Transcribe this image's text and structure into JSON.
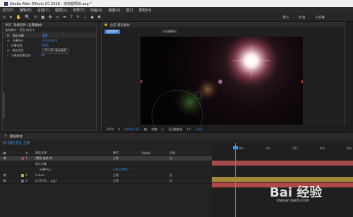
{
  "titlebar": {
    "title": "Adobe After Effects CC 2018 - 无标题项目.aep *"
  },
  "menu": [
    "文件(F)",
    "编辑(E)",
    "合成(C)",
    "图层(L)",
    "效果(T)",
    "动画(A)",
    "视图(V)",
    "窗口",
    "帮助(H)"
  ],
  "toolbar": {
    "workspaces": [
      "默认",
      "标准",
      "小屏幕"
    ]
  },
  "left_panel": {
    "tabs": [
      "项目",
      "效果控件 (光晕素材)"
    ],
    "title": "粗角素材 • 黑色 纯色 1",
    "effect_name": "镜头光晕",
    "reset": "重置",
    "props": [
      {
        "name": "光晕中心",
        "value": "374.0,94.0"
      },
      {
        "name": "光晕亮度",
        "value": "129%"
      },
      {
        "name": "镜头类型",
        "value": "50-300 毫米变焦"
      },
      {
        "name": "与原始图像混合",
        "value": "0%"
      }
    ]
  },
  "viewer": {
    "tabs": [
      "合成 粗角素材"
    ],
    "comp_tab": "粗角素材",
    "top_label": "活动摄像机",
    "zoom": "100%",
    "timecode": "0:00:01:16",
    "quality": "完整",
    "camera": "活动摄像机",
    "views": "1个",
    "exposure": "+0.0"
  },
  "timeline": {
    "tab": "粗角素材",
    "timecode": "0:00:01:16",
    "headers": {
      "num": "#",
      "name": "图层名称",
      "mode": "模式",
      "trkmat": "TrkMat",
      "parent": "父级"
    },
    "ruler": [
      "00s",
      "01s",
      "02s",
      "03s",
      "04s"
    ],
    "layers": [
      {
        "num": "1",
        "name": "[黑色 纯色 1]",
        "mode": "正常",
        "parent": "无",
        "color": "#b83c3c"
      },
      {
        "num": "",
        "name": "镜头光晕",
        "mode": "",
        "parent": "",
        "color": ""
      },
      {
        "num": "",
        "name": "光晕中心",
        "mode": "",
        "parent": "374.0,94.0",
        "color": ""
      },
      {
        "num": "2",
        "name": "Future",
        "mode": "正常",
        "parent": "无",
        "color": "#c9a33a"
      },
      {
        "num": "3",
        "name": "[o-RSYS ... jpg]",
        "mode": "正常",
        "parent": "无",
        "color": "#4b6fb0"
      }
    ]
  },
  "watermark": {
    "text": "Bai 经验",
    "url": "jingyan.baidu.com"
  }
}
